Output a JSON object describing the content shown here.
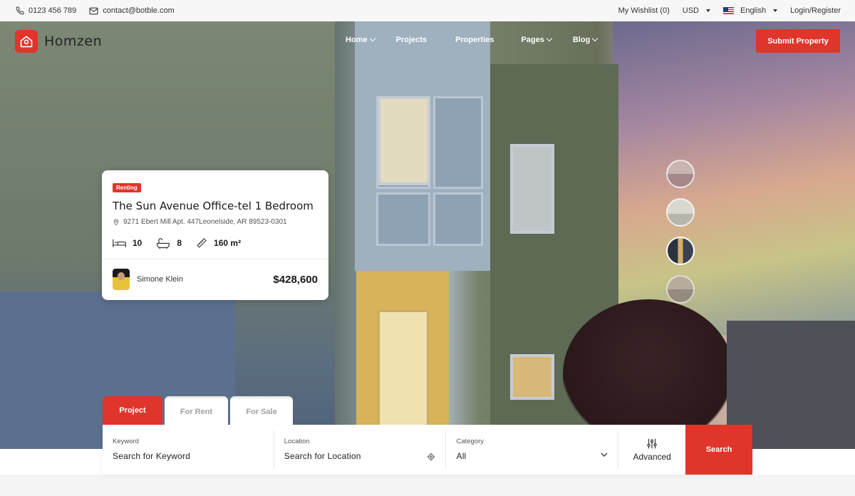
{
  "topbar": {
    "phone": "0123 456 789",
    "email": "contact@botble.com",
    "wishlist": "My Wishlist (0)",
    "currency": "USD",
    "language": "English",
    "auth": "Login/Register"
  },
  "header": {
    "brand": "Homzen",
    "nav": [
      {
        "label": "Home",
        "has_dropdown": true
      },
      {
        "label": "Projects",
        "has_dropdown": false
      },
      {
        "label": "Properties",
        "has_dropdown": false
      },
      {
        "label": "Pages",
        "has_dropdown": true
      },
      {
        "label": "Blog",
        "has_dropdown": true
      }
    ],
    "submit_label": "Submit Property"
  },
  "card": {
    "badge": "Renting",
    "title": "The Sun Avenue Office-tel 1 Bedroom",
    "address": "9271 Ebert Mill Apt. 447Leonelside, AR 89523-0301",
    "beds": "10",
    "baths": "8",
    "area": "160 m²",
    "agent": "Simone Klein",
    "price": "$428,600"
  },
  "search": {
    "tabs": [
      {
        "label": "Project",
        "active": true
      },
      {
        "label": "For Rent",
        "active": false
      },
      {
        "label": "For Sale",
        "active": false
      }
    ],
    "keyword": {
      "label": "Keyword",
      "placeholder": "Search for Keyword"
    },
    "location": {
      "label": "Location",
      "placeholder": "Search for Location"
    },
    "category": {
      "label": "Category",
      "value": "All"
    },
    "advanced_label": "Advanced",
    "search_label": "Search"
  },
  "colors": {
    "accent": "#e0352b"
  }
}
